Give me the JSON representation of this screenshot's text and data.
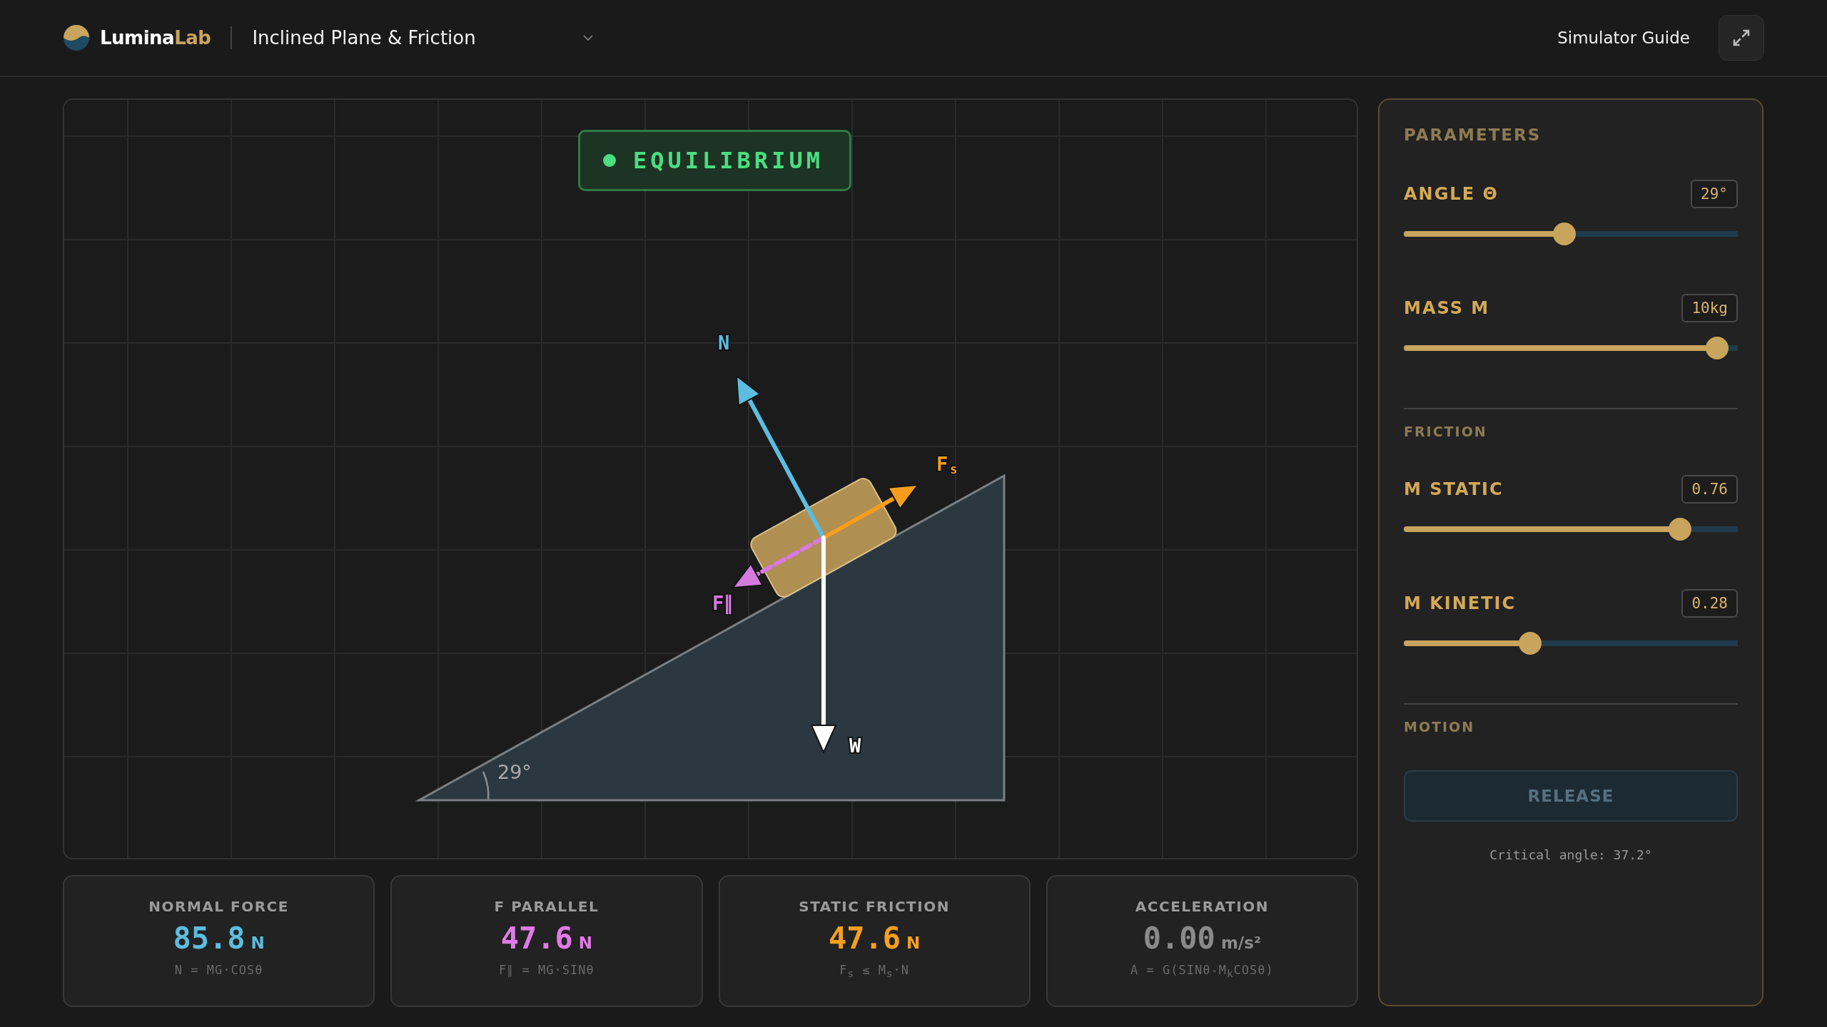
{
  "header": {
    "brand_primary": "Lumina",
    "brand_accent": "Lab",
    "simulation": "Inclined Plane & Friction",
    "guide_link": "Simulator Guide"
  },
  "status": {
    "kind": "equilibrium",
    "label": "EQUILIBRIUM"
  },
  "diagram": {
    "angle_label": "29°",
    "forces": [
      {
        "kind": "normal",
        "label": "N",
        "color": "#5bbde0"
      },
      {
        "kind": "friction",
        "label": "F",
        "subscript": "s",
        "color": "#f59e1b"
      },
      {
        "kind": "parallel",
        "label": "F∥",
        "color": "#d77ae0"
      },
      {
        "kind": "weight",
        "label": "W",
        "color": "#ffffff"
      }
    ]
  },
  "parameters": {
    "title": "PARAMETERS",
    "sections": [
      {
        "sliders": [
          {
            "label": "ANGLE Θ",
            "value": "29°",
            "level": 0.48
          },
          {
            "label": "MASS M",
            "value": "10kg",
            "level": 0.97
          }
        ]
      },
      {
        "title": "FRICTION",
        "sliders": [
          {
            "label": "Μ STATIC",
            "value": "0.76",
            "level": 0.85
          },
          {
            "label": "Μ KINETIC",
            "value": "0.28",
            "level": 0.37
          }
        ]
      },
      {
        "title": "MOTION",
        "button": {
          "label": "RELEASE",
          "disabled": true
        },
        "note": "Critical angle: 37.2°"
      }
    ]
  },
  "stats": [
    {
      "label": "NORMAL FORCE",
      "value": "85.8",
      "unit": "N",
      "formula": "N = MG·COSθ",
      "color": "#5bbde0"
    },
    {
      "label": "F PARALLEL",
      "value": "47.6",
      "unit": "N",
      "formula": "F∥ = MG·SINθ",
      "color": "#e07ae8"
    },
    {
      "label": "STATIC FRICTION",
      "value": "47.6",
      "unit": "N",
      "formula": "F$_{s}$ ≤ M$_{s}$·N",
      "color": "#f5a01e"
    },
    {
      "label": "ACCELERATION",
      "value": "0.00",
      "unit": "m/s²",
      "formula": "A = G(SINθ-M$_{k}$COSθ)",
      "color": "#8a8a8a"
    }
  ]
}
